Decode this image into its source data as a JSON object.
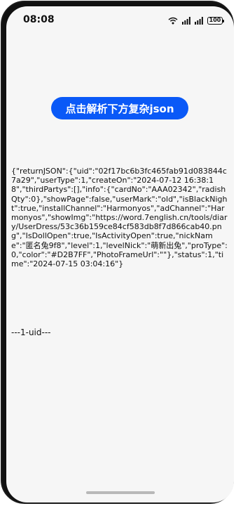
{
  "status_bar": {
    "time": "08:08",
    "battery": "100",
    "icons": [
      "wifi-icon",
      "signal-icon",
      "signal-icon",
      "battery-icon"
    ]
  },
  "main": {
    "button_label": "点击解析下方复杂json",
    "json_text": "{\"returnJSON\":{\"uid\":\"02f17bc6b3fc465fab91d083844c7a29\",\"userType\":1,\"createOn\":\"2024-07-12 16:38:18\",\"thirdPartys\":[],\"info\":{\"cardNo\":\"AAA02342\",\"radishQty\":0},\"showPage\":false,\"userMark\":\"old\",\"isBlackNight\":true,\"installChannel\":\"Harmonyos\",\"adChannel\":\"Harmonyos\",\"showImg\":\"https://word.7english.cn/tools/diary/UserDress/53c36b159ce84cf583db8f7d866cab40.png\",\"IsDollOpen\":true,\"IsActivityOpen\":true,\"nickName\":\"匿名兔9f8\",\"level\":1,\"levelNick\":\"萌新出兔\",\"proType\":0,\"color\":\"#D2B7FF\",\"PhotoFrameUrl\":\"\"},\"status\":1,\"time\":\"2024-07-15 03:04:16\"}",
    "result_label": "---1-uid---"
  },
  "colors": {
    "button": "#0a59f7",
    "background": "#f6f6f6"
  }
}
